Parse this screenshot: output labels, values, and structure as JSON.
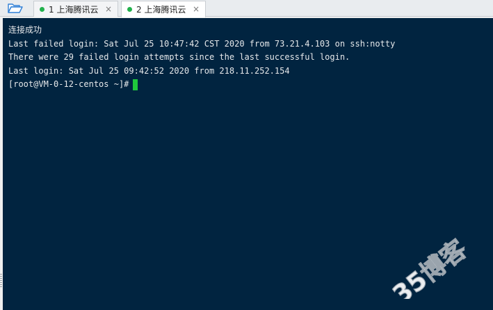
{
  "tabs": [
    {
      "label": "1 上海腾讯云",
      "status_color": "#22b14c",
      "active": false
    },
    {
      "label": "2 上海腾讯云",
      "status_color": "#22b14c",
      "active": true
    }
  ],
  "icons": {
    "folder": "folder-open-icon",
    "close": "close-icon"
  },
  "terminal": {
    "background": "#012440",
    "cursor_color": "#1fc83c",
    "lines": [
      "连接成功",
      "Last failed login: Sat Jul 25 10:47:42 CST 2020 from 73.21.4.103 on ssh:notty",
      "There were 29 failed login attempts since the last successful login.",
      "Last login: Sat Jul 25 09:42:52 2020 from 218.11.252.154"
    ],
    "prompt": "[root@VM-0-12-centos ~]#"
  },
  "watermark": {
    "text": "35博客"
  },
  "close_glyph": "×"
}
